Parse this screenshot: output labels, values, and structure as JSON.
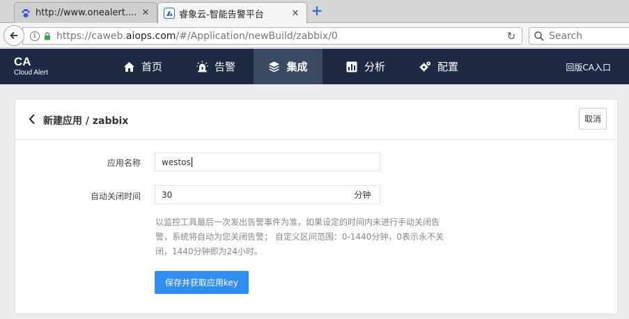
{
  "browser": {
    "tabs": [
      {
        "title": "http://www.onealert....",
        "favicon": "baidu-paw-icon",
        "active": false
      },
      {
        "title": "睿象云-智能告警平台",
        "favicon": "onealert-logo-icon",
        "active": true
      }
    ],
    "url": {
      "prefix": "https://caweb.",
      "domain": "aiops.com",
      "path": "/#/Application/newBuild/zabbix/0"
    },
    "search_placeholder": "Search"
  },
  "app": {
    "logo": {
      "main": "CA",
      "sub": "Cloud Alert"
    },
    "nav": [
      {
        "label": "首页",
        "icon": "home-icon",
        "active": false
      },
      {
        "label": "告警",
        "icon": "alarm-light-icon",
        "active": false
      },
      {
        "label": "集成",
        "icon": "layers-icon",
        "active": true
      },
      {
        "label": "分析",
        "icon": "bar-chart-icon",
        "active": false
      },
      {
        "label": "配置",
        "icon": "gears-icon",
        "active": false
      }
    ],
    "old_version_link": "回版CA入口",
    "accent_color": "#2f8ef0",
    "header_color": "#1e2a44"
  },
  "page": {
    "title": "新建应用 / zabbix",
    "cancel_label": "取消",
    "form": {
      "app_name_label": "应用名称",
      "app_name_value": "westos",
      "auto_close_label": "自动关闭时间",
      "auto_close_value": "30",
      "auto_close_unit": "分钟",
      "hint_lines": [
        "以监控工具最后一次发出告警事件为准，如果设定的时间内未进行手动关闭告",
        "警，系统将自动为您关闭告警； 自定义区间范围：0-1440分钟，0表示永不关",
        "闭，1440分钟即为24小时。"
      ],
      "submit_label": "保存并获取应用key"
    }
  }
}
